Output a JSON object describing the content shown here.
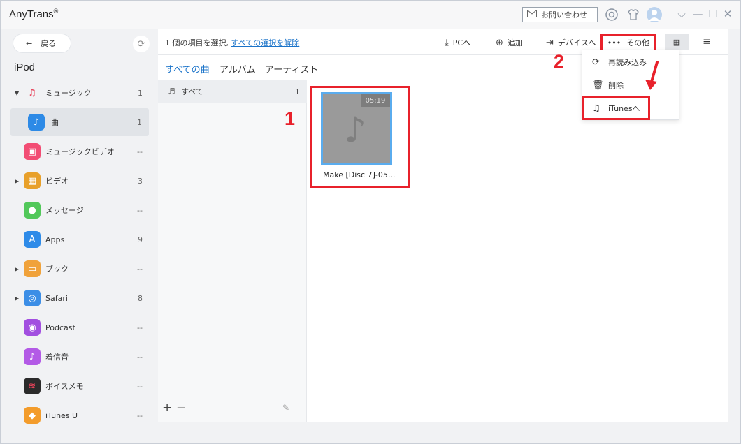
{
  "window": {
    "app_title": "AnyTrans",
    "registered_mark": "®",
    "contact_label": "お問い合わせ"
  },
  "sidebar": {
    "back_label": "戻る",
    "device_name": "iPod",
    "items": [
      {
        "label": "ミュージック",
        "count": "1",
        "icon": "music-icon",
        "color": "#ffffff",
        "expandable": true
      },
      {
        "label": "曲",
        "count": "1",
        "icon": "song-icon",
        "color": "#2d8ae6",
        "active": true
      },
      {
        "label": "ミュージックビデオ",
        "count": "--",
        "icon": "music-video-icon",
        "color": "#f24d74"
      },
      {
        "label": "ビデオ",
        "count": "3",
        "icon": "video-icon",
        "color": "#e8a02a",
        "expandable": true
      },
      {
        "label": "メッセージ",
        "count": "--",
        "icon": "message-icon",
        "color": "#52c85a"
      },
      {
        "label": "Apps",
        "count": "9",
        "icon": "apps-icon",
        "color": "#2e8be8"
      },
      {
        "label": "ブック",
        "count": "--",
        "icon": "book-icon",
        "color": "#f0a23a",
        "expandable": true
      },
      {
        "label": "Safari",
        "count": "8",
        "icon": "safari-icon",
        "color": "#3c8ee6",
        "expandable": true
      },
      {
        "label": "Podcast",
        "count": "--",
        "icon": "podcast-icon",
        "color": "#a24fe0"
      },
      {
        "label": "着信音",
        "count": "--",
        "icon": "ringtone-icon",
        "color": "#b35ae6"
      },
      {
        "label": "ボイスメモ",
        "count": "--",
        "icon": "voice-memo-icon",
        "color": "#2b2b2b"
      },
      {
        "label": "iTunes U",
        "count": "--",
        "icon": "itunes-u-icon",
        "color": "#f39c2b"
      }
    ]
  },
  "toolbar": {
    "selection_info": "1 個の項目を選択,",
    "deselect_all": "すべての選択を解除",
    "to_pc": "PCへ",
    "add": "追加",
    "to_device": "デバイスへ",
    "other": "その他"
  },
  "tabs": [
    "すべての曲",
    "アルバム",
    "アーティスト"
  ],
  "list": {
    "row_label": "すべて",
    "row_count": "1"
  },
  "song": {
    "duration": "05:19",
    "name": "Make [Disc 7]-05..."
  },
  "dropdown": {
    "items": [
      "再読み込み",
      "削除",
      "iTunesへ"
    ]
  },
  "annotations": {
    "step1": "1",
    "step2": "2"
  },
  "colors": {
    "accent": "#1a73c9",
    "highlight": "#e8212b",
    "selection_border": "#5aacee"
  }
}
